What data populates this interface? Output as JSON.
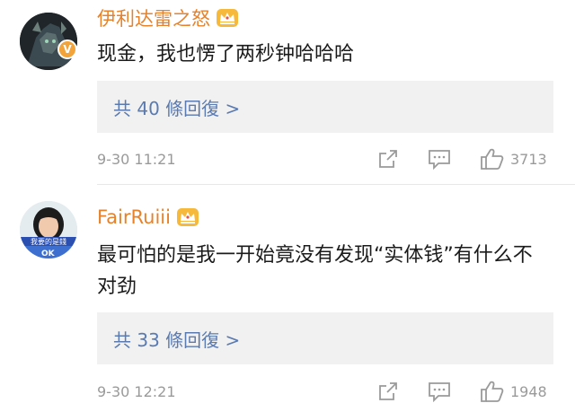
{
  "comments": [
    {
      "username": "伊利达雷之怒",
      "text": "现金，我也愣了两秒钟哈哈哈",
      "replies_label": "共 40 條回復 >",
      "timestamp": "9-30 11:21",
      "likes": "3713",
      "verified_badge": "V",
      "crown_icon": "crown-badge-icon"
    },
    {
      "username": "FairRuiii",
      "text": "最可怕的是我一开始竟没有发现“实体钱”有什么不对劲",
      "replies_label": "共 33 條回復 >",
      "timestamp": "9-30 12:21",
      "likes": "1948",
      "avatar_caption_top": "我要的是錢",
      "avatar_caption_bottom": "OK",
      "crown_icon": "crown-badge-icon"
    }
  ],
  "colors": {
    "username": "#e8822a",
    "reply_link": "#5a7ab0",
    "reply_bg": "#f1f1f1",
    "meta": "#9a9a9a",
    "verified": "#f2a33a"
  }
}
